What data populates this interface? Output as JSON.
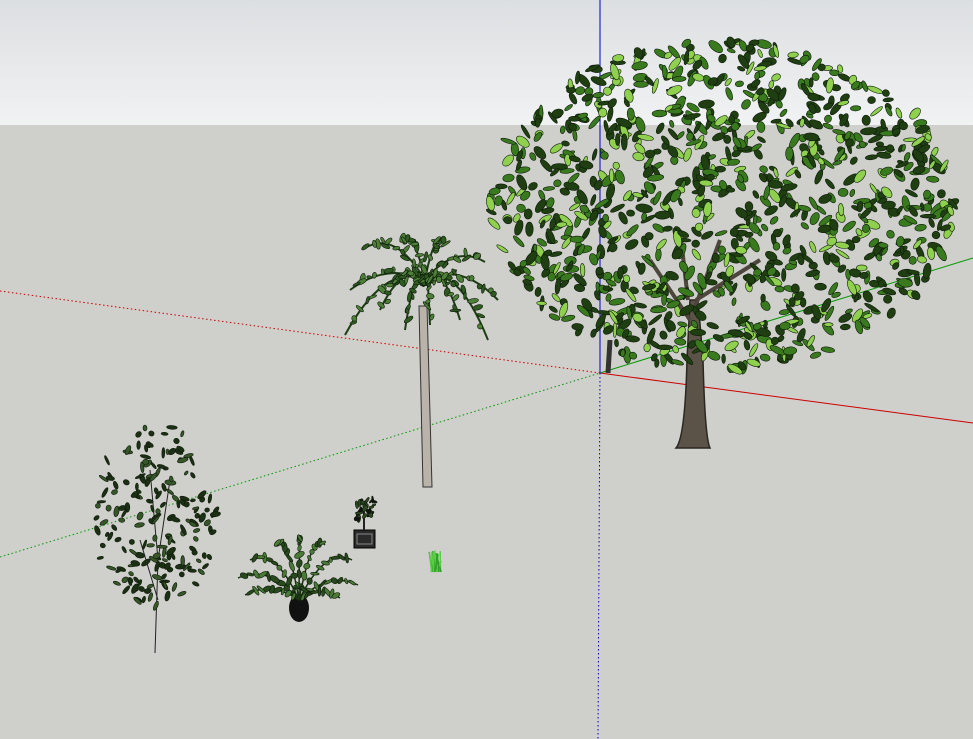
{
  "scene": {
    "sky_color_top": "#dcdfe1",
    "sky_color_bottom": "#eff0f1",
    "ground_color": "#cfcfcb",
    "axes": {
      "x_axis_color": "#cc0000",
      "y_axis_color": "#009900",
      "z_axis_color": "#0000cc"
    },
    "foliage_colors": {
      "dark": "#1f3f12",
      "mid": "#3a7a1f",
      "light": "#8fd14f"
    },
    "models": [
      {
        "id": "large-tree",
        "label_icon": "deciduous-tree-icon"
      },
      {
        "id": "palm-tree",
        "label_icon": "palm-tree-icon"
      },
      {
        "id": "small-tree",
        "label_icon": "sapling-tree-icon"
      },
      {
        "id": "cycad-plant",
        "label_icon": "cycad-icon"
      },
      {
        "id": "potted-plant",
        "label_icon": "potted-plant-icon"
      },
      {
        "id": "grass-tuft",
        "label_icon": "grass-icon"
      }
    ]
  }
}
